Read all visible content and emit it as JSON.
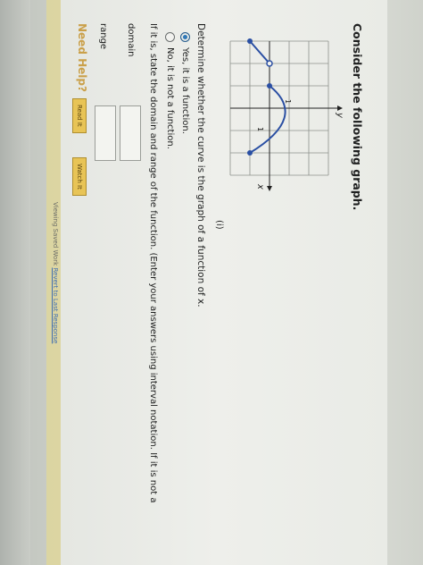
{
  "question": {
    "title": "Consider the following graph.",
    "graph": {
      "y_label": "y",
      "x_label": "x",
      "tick_x": "1",
      "tick_y": "1"
    },
    "info_glyph": "i",
    "prompt": "Determine whether the curve is the graph of a function of x.",
    "options": [
      {
        "label": "Yes, it is a function.",
        "selected": true
      },
      {
        "label": "No, it is not a function.",
        "selected": false
      }
    ],
    "instructions": "If it is, state the domain and range of the function. (Enter your answers using interval notation. If it is not a",
    "domain_label": "domain",
    "range_label": "range",
    "domain_value": "",
    "range_value": ""
  },
  "help": {
    "label": "Need Help?",
    "read_button": "Read It",
    "watch_button": "Watch It"
  },
  "footer": {
    "text": "Viewing Saved Work",
    "link": "Revert to Last Response"
  },
  "colors": {
    "curve": "#2a4fa3",
    "button": "#e8c456",
    "help": "#caa04a"
  }
}
